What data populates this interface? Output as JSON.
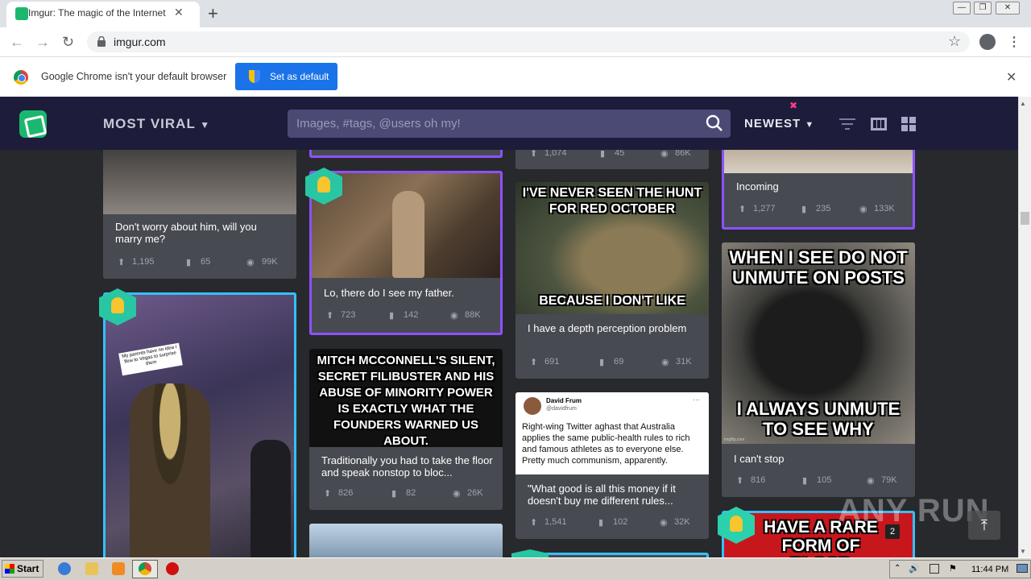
{
  "browser": {
    "tab_title": "Imgur: The magic of the Internet",
    "url": "imgur.com",
    "infobar_text": "Google Chrome isn't your default browser",
    "set_default_label": "Set as default"
  },
  "imgur": {
    "section": "MOST VIRAL",
    "search_placeholder": "Images, #tags, @users oh my!",
    "sort": "NEWEST"
  },
  "posts": [
    {
      "title": "Don't worry about him, will you marry me?",
      "ups": "1,195",
      "comments": "65",
      "views": "99K",
      "caption": ""
    },
    {
      "title": "",
      "ups": "",
      "comments": "",
      "views": "",
      "caption": "My parents have no idea I flew to Vegas to surprise them"
    },
    {
      "title": "Lo, there do I see my father.",
      "ups": "723",
      "comments": "142",
      "views": "88K"
    },
    {
      "title": "Traditionally you had to take the floor and speak nonstop to bloc...",
      "ups": "826",
      "comments": "82",
      "views": "26K",
      "meme": "MITCH MCCONNELL'S SILENT, SECRET FILIBUSTER AND HIS ABUSE OF MINORITY POWER IS EXACTLY WHAT THE FOUNDERS WARNED US ABOUT."
    },
    {
      "title": "",
      "ups": "1,074",
      "comments": "45",
      "views": "86K"
    },
    {
      "title": "I have a depth perception problem",
      "ups": "691",
      "comments": "69",
      "views": "31K",
      "meme_top": "I'VE NEVER SEEN THE HUNT FOR RED OCTOBER",
      "meme_bottom": "BECAUSE I DON'T LIKE MOVIES WITH SUB TITLES"
    },
    {
      "title": "\"What good is all this money if it doesn't buy me different rules...",
      "ups": "1,541",
      "comments": "102",
      "views": "32K",
      "tweet_name": "David Frum",
      "tweet_handle": "@davidfrum",
      "tweet_text": "Right-wing Twitter aghast that Australia applies the same public-health rules to rich and famous athletes as to everyone else. Pretty much communism, apparently."
    },
    {
      "title": "Incoming",
      "ups": "1,277",
      "comments": "235",
      "views": "133K"
    },
    {
      "title": "I can't stop",
      "ups": "816",
      "comments": "105",
      "views": "79K",
      "meme_top": "WHEN I SEE DO NOT UNMUTE ON POSTS",
      "meme_bottom": "I ALWAYS UNMUTE TO SEE WHY",
      "credit": "imgflip.com"
    },
    {
      "title": "",
      "meme": "HAVE A RARE FORM OF BLOOD CANCER",
      "badge_count": "2"
    }
  ],
  "watermark": "ANY RUN",
  "taskbar": {
    "start": "Start",
    "clock": "11:44 PM"
  }
}
